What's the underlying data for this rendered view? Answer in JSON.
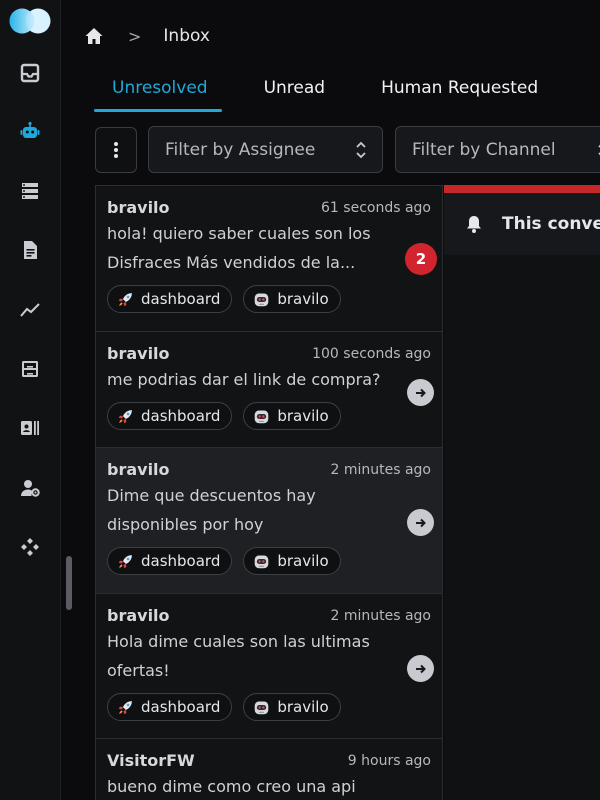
{
  "breadcrumb": {
    "current": "Inbox",
    "separator": ">"
  },
  "tabs": [
    {
      "label": "Unresolved",
      "active": true
    },
    {
      "label": "Unread",
      "active": false
    },
    {
      "label": "Human Requested",
      "active": false
    }
  ],
  "filters": {
    "assignee_label": "Filter by Assignee",
    "channel_label": "Filter by Channel"
  },
  "conversations": [
    {
      "name": "bravilo",
      "time": "61 seconds ago",
      "message": "hola! quiero saber cuales son los Disfraces Más vendidos de la...",
      "unread": "2",
      "tags": [
        "dashboard",
        "bravilo"
      ]
    },
    {
      "name": "bravilo",
      "time": "100 seconds ago",
      "message": "me podrias dar el link de compra?",
      "tags": [
        "dashboard",
        "bravilo"
      ]
    },
    {
      "name": "bravilo",
      "time": "2 minutes ago",
      "message": "Dime que descuentos hay disponibles por hoy",
      "tags": [
        "dashboard",
        "bravilo"
      ]
    },
    {
      "name": "bravilo",
      "time": "2 minutes ago",
      "message": "Hola dime cuales son las ultimas ofertas!",
      "tags": [
        "dashboard",
        "bravilo"
      ]
    },
    {
      "name": "VisitorFW",
      "time": "9 hours ago",
      "message": "bueno dime como creo una api"
    }
  ],
  "pane": {
    "banner_text": "This conve"
  },
  "colors": {
    "accent": "#1fa8d8",
    "badge": "#d1242f",
    "alert_bar": "#c62828"
  },
  "icons": {
    "sidebar": [
      "inbox-icon",
      "bot-icon",
      "datastores-icon",
      "document-icon",
      "analytics-icon",
      "archive-icon",
      "contacts-icon",
      "team-settings-icon",
      "integrations-icon"
    ]
  }
}
